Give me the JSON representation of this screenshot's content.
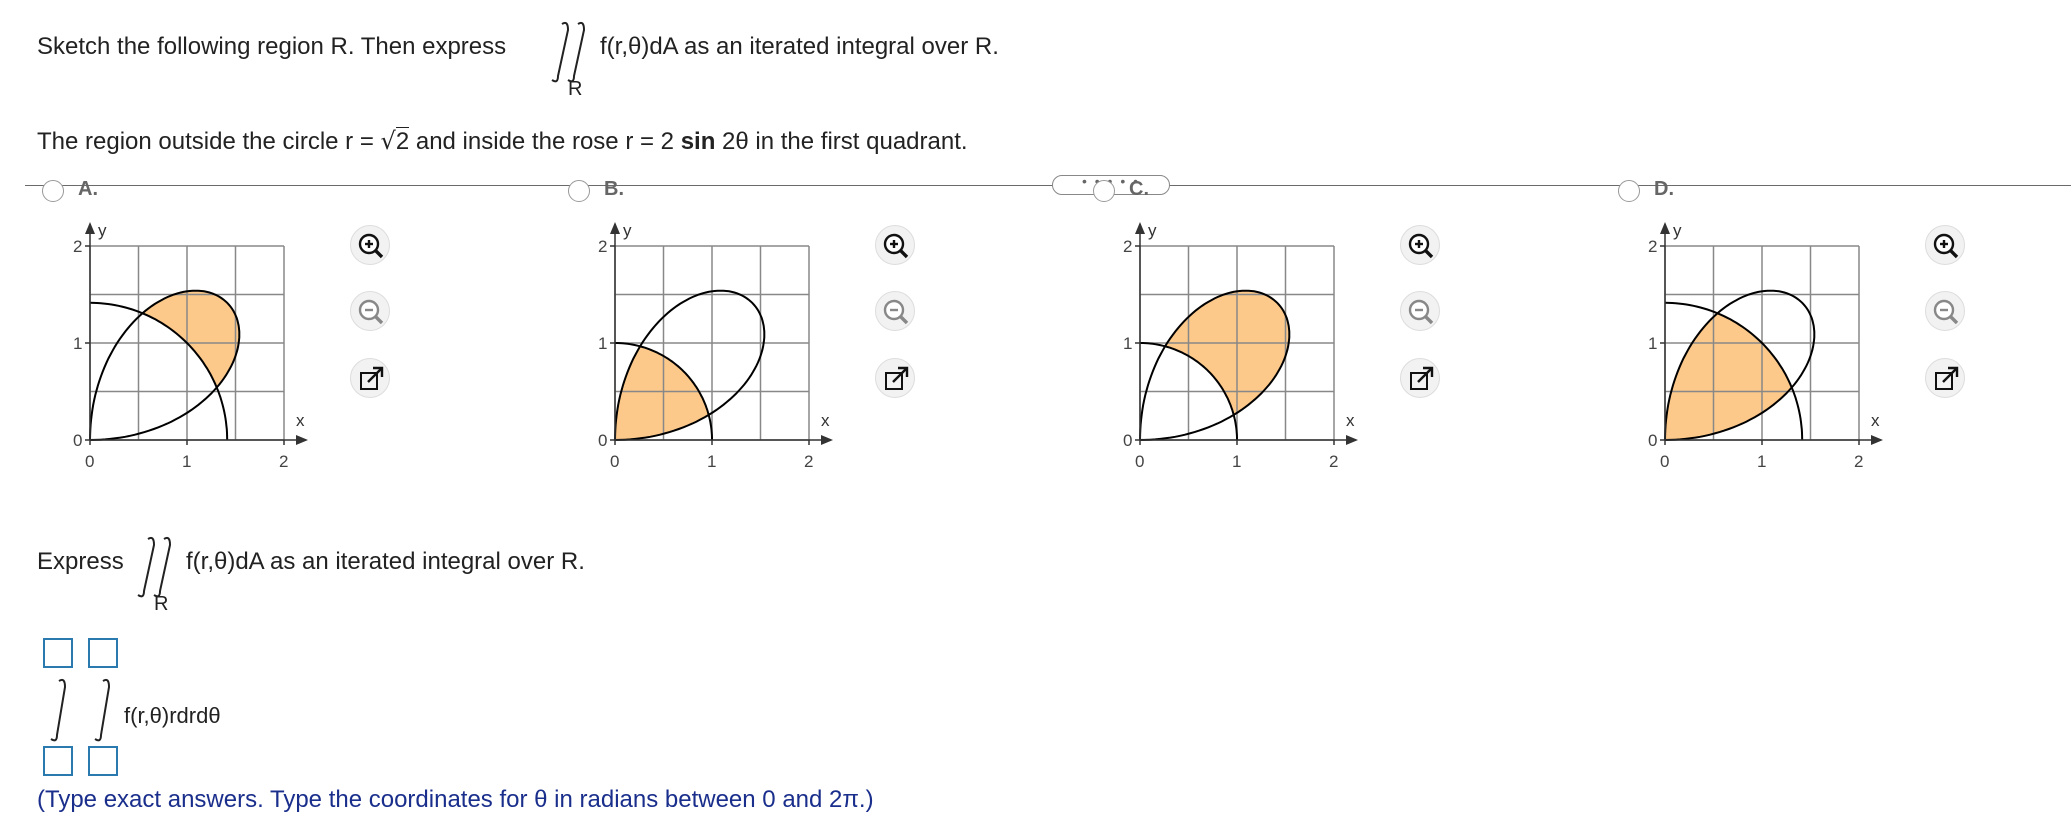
{
  "question": {
    "prefix": "Sketch the following region R. Then express",
    "integrand": "f(r,θ)dA as an iterated integral over R.",
    "subscript": "R",
    "region_prefix": "The region outside the circle r =",
    "sqrt_value": "2",
    "region_mid": "and inside the rose r = 2",
    "region_sin": "sin",
    "region_suffix": "2θ in the first quadrant."
  },
  "options": [
    {
      "label": "A."
    },
    {
      "label": "B."
    },
    {
      "label": "C."
    },
    {
      "label": "D."
    }
  ],
  "graph_labels": {
    "y": "y",
    "x": "x",
    "y_ticks": [
      "2",
      "1",
      "0"
    ],
    "x_ticks": [
      "0",
      "1",
      "2"
    ]
  },
  "express": {
    "prefix": "Express",
    "integrand": "f(r,θ)dA as an iterated integral over R.",
    "subscript": "R"
  },
  "answer": {
    "integrand": "f(r,θ)rdrdθ",
    "hint": "(Type exact answers. Type the coordinates for θ in radians between 0 and 2π.)"
  },
  "colors": {
    "fill": "#fcc98b",
    "grid": "#888888",
    "divider": "#6b6b6b",
    "answer_box": "#2a7ab0",
    "hint": "#1a2e8c"
  }
}
